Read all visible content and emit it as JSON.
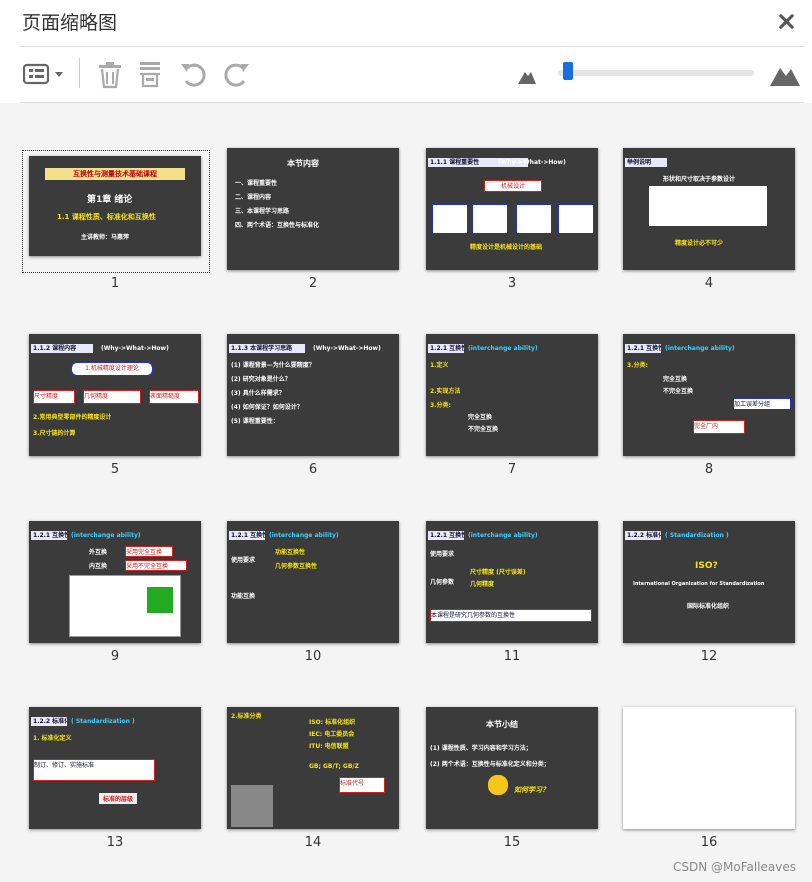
{
  "panel": {
    "title": "页面缩略图"
  },
  "toolbar": {
    "icons": [
      "thumbnail-options-icon",
      "delete-page-icon",
      "extract-pages-icon",
      "undo-icon",
      "redo-icon",
      "zoom-out-mountain-icon",
      "zoom-in-mountain-icon"
    ],
    "slider_level": 0.05,
    "accent": "#1a6fe0"
  },
  "pages": [
    {
      "num": "1",
      "lines": [
        "互换性与测量技术基础课程",
        "第1章 绪论",
        "1.1 课程性质、标准化和互换性",
        "主讲教师：马惠萍"
      ]
    },
    {
      "num": "2",
      "lines": [
        "本节内容",
        "一、课程重要性",
        "二、课程内容",
        "三、本课程学习思路",
        "四、两个术语：互换性与标准化"
      ]
    },
    {
      "num": "3",
      "lines": [
        "1.1.1 课程重要性",
        "(Why->What->How)",
        "机械设计",
        "精度设计是机械设计的基础"
      ]
    },
    {
      "num": "4",
      "lines": [
        "举例说明",
        "形状和尺寸取决于参数设计",
        "精度设计必不可少"
      ]
    },
    {
      "num": "5",
      "lines": [
        "1.1.2 课程内容",
        "(Why->What->How)",
        "1.机械精度设计理论",
        "尺寸精度",
        "几何精度",
        "表面精糙度",
        "2.常用典型零部件的精度设计",
        "3.尺寸链的计算"
      ]
    },
    {
      "num": "6",
      "lines": [
        "1.1.3 本课程学习思路",
        "(Why->What->How)",
        "(1) 课程背景—为什么要精度？",
        "(2) 研究对象是什么？",
        "(3) 具什么样需求？",
        "(4) 如何保证？如何设计？",
        "(5) 课程重要性："
      ]
    },
    {
      "num": "7",
      "lines": [
        "1.2.1 互换性",
        "(interchange ability)",
        "1.定义",
        "2.实现方法",
        "3.分类:",
        "完全互换",
        "不完全互换"
      ]
    },
    {
      "num": "8",
      "lines": [
        "1.2.1 互换性",
        "(interchange ability)",
        "3.分类:",
        "完全互换",
        "不完全互换",
        "加工误差分组",
        "完全厂内"
      ]
    },
    {
      "num": "9",
      "lines": [
        "1.2.1 互换性",
        "(interchange ability)",
        "外互换",
        "内互换",
        "采用完全互换",
        "采用不完全互换"
      ]
    },
    {
      "num": "10",
      "lines": [
        "1.2.1 互换性",
        "(interchange ability)",
        "使用要求",
        "功能互换",
        "功能互换性",
        "几何参数互换性"
      ]
    },
    {
      "num": "11",
      "lines": [
        "1.2.1 互换性",
        "(interchange ability)",
        "使用要求",
        "几何参数",
        "尺寸精度 (尺寸误差)",
        "几何精度",
        "本课程是研究几何参数的互换性"
      ]
    },
    {
      "num": "12",
      "lines": [
        "1.2.2 标准化",
        "( Standardization )",
        "ISO?",
        "International Organization for Standardization",
        "国际标准化组织"
      ]
    },
    {
      "num": "13",
      "lines": [
        "1.2.2 标准化",
        "( Standardization )",
        "1. 标准化定义",
        "制订、修订、实施标准",
        "标准的层级"
      ]
    },
    {
      "num": "14",
      "lines": [
        "2.标准分类",
        "ISO: 标准化组织",
        "IEC: 电工委员会",
        "ITU: 电信联盟",
        "GB; GB/T; GB/Z",
        "标准代号"
      ]
    },
    {
      "num": "15",
      "lines": [
        "本节小结",
        "(1) 课程性质、学习内容和学习方法；",
        "(2) 两个术语：互换性与标准化定义和分类；",
        "如何学习？"
      ]
    },
    {
      "num": "16",
      "lines": []
    }
  ],
  "watermark": "CSDN @MoFalleaves"
}
